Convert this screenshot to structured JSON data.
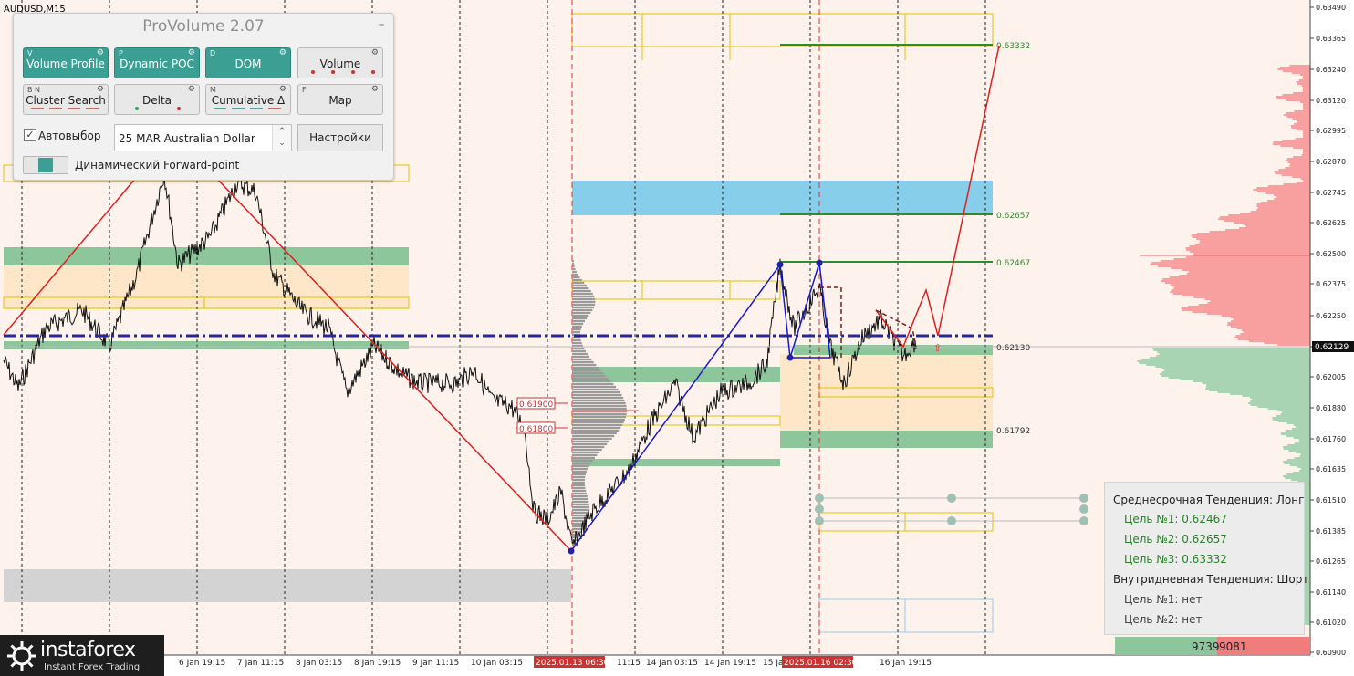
{
  "chart": {
    "symbol": "AUDUSD,M15",
    "last_price": "0.62129",
    "price_axis": [
      "0.63490",
      "0.63365",
      "0.63240",
      "0.63120",
      "0.62995",
      "0.62870",
      "0.62745",
      "0.62625",
      "0.62500",
      "0.62375",
      "0.62250",
      "0.62130",
      "0.62005",
      "0.61880",
      "0.61760",
      "0.61635",
      "0.61510",
      "0.61385",
      "0.61265",
      "0.61140",
      "0.61020",
      "0.60900"
    ],
    "time_axis": [
      "6 Jan 19:15",
      "7 Jan 11:15",
      "8 Jan 03:15",
      "8 Jan 19:15",
      "9 Jan 11:15",
      "10 Jan 03:15",
      "2025.01.13 06:30",
      "11:15",
      "14 Jan 03:15",
      "14 Jan 19:15",
      "15 Ja",
      "2025.01.16 02:30",
      "16 Jan 19:15"
    ],
    "level_labels": {
      "l63332": "0.63332",
      "l62657": "0.62657",
      "l62467": "0.62467",
      "l62130": "0.62130",
      "l61792": "0.61792",
      "l61900": "0.61900",
      "l61800": "0.61800"
    },
    "colors": {
      "background": "#fdf3ec",
      "bull_zone": "#8ec69c",
      "cream_zone": "#fde7c8",
      "blue_zone": "#87ceeb",
      "gray_zone": "#d3d3d3",
      "target_line": "#2e8b2e",
      "pivot_line": "#27279b",
      "red_path": "#dd2020",
      "blue_path": "#1a1acc",
      "vol_red": "#f8a0a0",
      "vol_green": "#a8d4b4"
    }
  },
  "panel": {
    "title": "ProVolume 2.07",
    "buttons": [
      {
        "label": "Volume Profile",
        "key": "V",
        "state": "on"
      },
      {
        "label": "Dynamic POC",
        "key": "P",
        "state": "on"
      },
      {
        "label": "DOM",
        "key": "D",
        "state": "on"
      },
      {
        "label": "Volume",
        "key": "",
        "state": "off"
      },
      {
        "label": "Cluster Search",
        "key": "B  N",
        "state": "off"
      },
      {
        "label": "Delta",
        "key": "",
        "state": "off"
      },
      {
        "label": "Cumulative Δ",
        "key": "M",
        "state": "off"
      },
      {
        "label": "Map",
        "key": "F",
        "state": "off"
      }
    ],
    "autoselect_label": "Автовыбор",
    "autoselect_checked": true,
    "instrument": "25 MAR Australian Dollar",
    "settings_label": "Настройки",
    "forward_point_label": "Динамический Forward-point"
  },
  "trend_box": {
    "mid_title": "Среднесрочная Тенденция: Лонг",
    "mid_targets": [
      "Цель №1: 0.62467",
      "Цель №2: 0.62657",
      "Цель №3: 0.63332"
    ],
    "intra_title": "Внутридневная Тенденция: Шорт",
    "intra_targets": [
      "Цель №1: нет",
      "Цель №2: нет"
    ]
  },
  "volume_footer": {
    "buy": "9739",
    "sell": "9081"
  },
  "logo": {
    "name": "instaforex",
    "tagline": "Instant Forex Trading"
  }
}
